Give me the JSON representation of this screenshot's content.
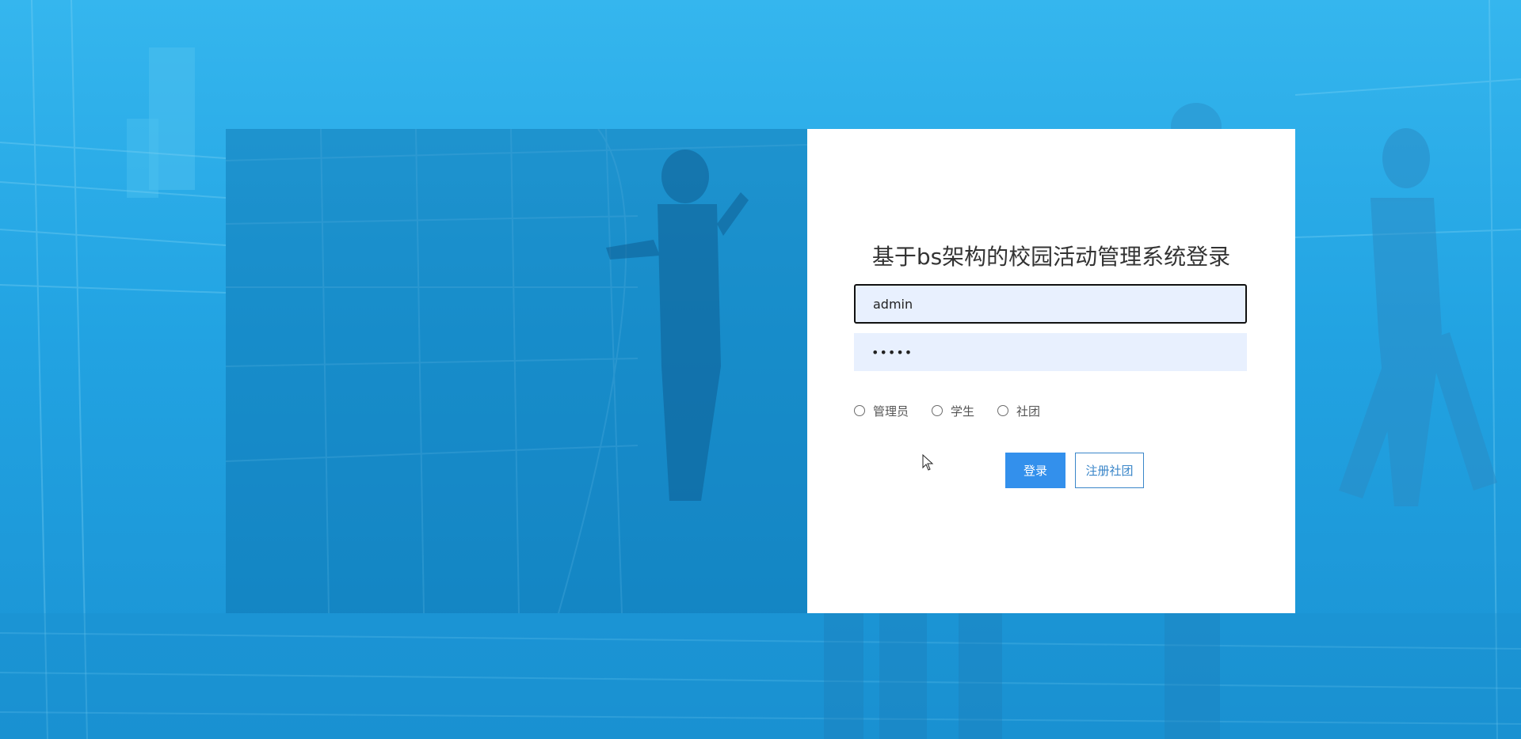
{
  "login": {
    "title": "基于bs架构的校园活动管理系统登录",
    "username_value": "admin",
    "password_value": "•••••",
    "roles": [
      {
        "label": "管理员",
        "selected": false
      },
      {
        "label": "学生",
        "selected": false
      },
      {
        "label": "社团",
        "selected": false
      }
    ],
    "login_button": "登录",
    "register_button": "注册社团"
  },
  "colors": {
    "background": "#29acea",
    "primary": "#3390ec",
    "input_bg": "#e8f0fe",
    "register_border": "#3a86c9"
  }
}
